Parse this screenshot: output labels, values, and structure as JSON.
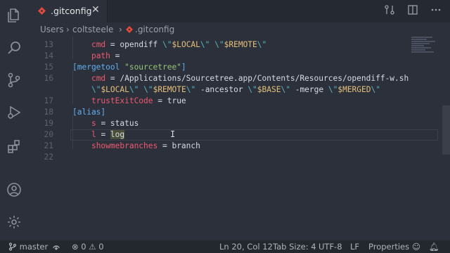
{
  "tab": {
    "filename": ".gitconfig",
    "close_glyph": "✕"
  },
  "breadcrumb": {
    "items": [
      "Users",
      "coltsteele",
      ".gitconfig"
    ],
    "separator": "›"
  },
  "editor": {
    "lines": [
      {
        "num": "13",
        "indent": "    ",
        "parts": [
          [
            "k",
            "cmd"
          ],
          [
            "p",
            " = opendiff "
          ],
          [
            "e",
            "\\\""
          ],
          [
            "var",
            "$LOCAL"
          ],
          [
            "e",
            "\\\""
          ],
          [
            "p",
            " "
          ],
          [
            "e",
            "\\\""
          ],
          [
            "var",
            "$REMOTE"
          ],
          [
            "e",
            "\\\""
          ]
        ]
      },
      {
        "num": "14",
        "indent": "    ",
        "parts": [
          [
            "k",
            "path"
          ],
          [
            "p",
            " ="
          ]
        ]
      },
      {
        "num": "15",
        "indent": "",
        "parts": [
          [
            "sec",
            "[mergetool "
          ],
          [
            "s",
            "\"sourcetree\""
          ],
          [
            "sec",
            "]"
          ]
        ]
      },
      {
        "num": "16",
        "indent": "    ",
        "parts": [
          [
            "k",
            "cmd"
          ],
          [
            "p",
            " = /Applications/Sourcetree.app/Contents/Resources/opendiff-w.sh"
          ]
        ]
      },
      {
        "num": "",
        "indent": "    ",
        "parts": [
          [
            "e",
            "\\\""
          ],
          [
            "var",
            "$LOCAL"
          ],
          [
            "e",
            "\\\""
          ],
          [
            "p",
            " "
          ],
          [
            "e",
            "\\\""
          ],
          [
            "var",
            "$REMOTE"
          ],
          [
            "e",
            "\\\""
          ],
          [
            "p",
            " -ancestor "
          ],
          [
            "e",
            "\\\""
          ],
          [
            "var",
            "$BASE"
          ],
          [
            "e",
            "\\\""
          ],
          [
            "p",
            " -merge "
          ],
          [
            "e",
            "\\\""
          ],
          [
            "var",
            "$MERGED"
          ],
          [
            "e",
            "\\\""
          ]
        ]
      },
      {
        "num": "17",
        "indent": "    ",
        "parts": [
          [
            "k",
            "trustExitCode"
          ],
          [
            "p",
            " = true"
          ]
        ]
      },
      {
        "num": "18",
        "indent": "",
        "parts": [
          [
            "sec",
            "[alias]"
          ]
        ]
      },
      {
        "num": "19",
        "indent": "    ",
        "parts": [
          [
            "k",
            "s"
          ],
          [
            "p",
            " = status"
          ]
        ]
      },
      {
        "num": "20",
        "indent": "    ",
        "parts": [
          [
            "k",
            "l"
          ],
          [
            "p",
            " = "
          ],
          [
            "hl",
            "log"
          ]
        ]
      },
      {
        "num": "21",
        "indent": "    ",
        "parts": [
          [
            "k",
            "showmebranches"
          ],
          [
            "p",
            " = branch"
          ]
        ]
      },
      {
        "num": "22",
        "indent": "",
        "parts": []
      }
    ]
  },
  "status": {
    "branch": "master",
    "errors": "0",
    "warnings": "0",
    "position": "Ln 20, Col 12",
    "tab_size": "Tab Size: 4",
    "encoding": "UTF-8",
    "eol": "LF",
    "language": "Properties"
  },
  "colors": {
    "accent_red": "#e24a3b",
    "background": "#2b303b"
  }
}
